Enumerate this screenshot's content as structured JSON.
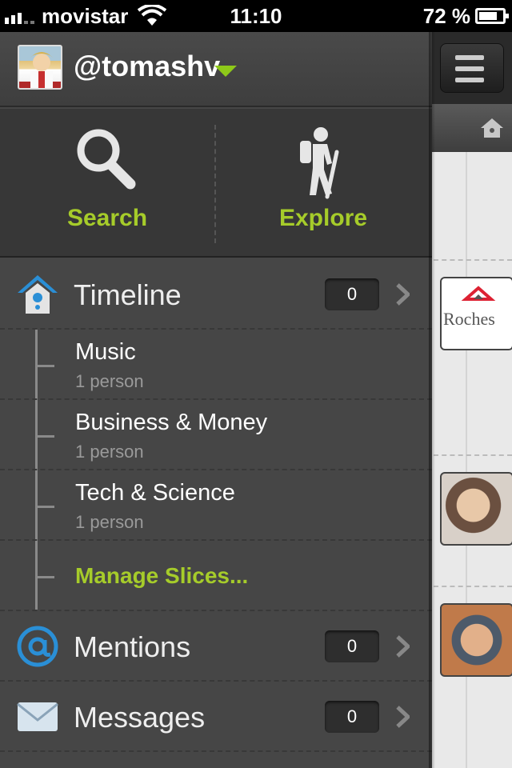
{
  "status_bar": {
    "carrier": "movistar",
    "time": "11:10",
    "battery": "72 %"
  },
  "profile": {
    "username": "@tomashv",
    "online_color": "#8ec919"
  },
  "actions": [
    {
      "label": "Search",
      "icon": "magnifier-icon"
    },
    {
      "label": "Explore",
      "icon": "hiker-icon"
    }
  ],
  "nav": {
    "timeline": {
      "title": "Timeline",
      "count": "0"
    },
    "mentions": {
      "title": "Mentions",
      "count": "0"
    },
    "messages": {
      "title": "Messages",
      "count": "0"
    }
  },
  "slices": [
    {
      "name": "Music",
      "members": "1 person"
    },
    {
      "name": "Business & Money",
      "members": "1 person"
    },
    {
      "name": "Tech & Science",
      "members": "1 person"
    }
  ],
  "manage_label": "Manage Slices...",
  "timeline_preview": {
    "logo_text": "Roches"
  },
  "colors": {
    "accent_green": "#a6cc2a",
    "menu_bg": "#464646",
    "mention_blue": "#2a8fd6"
  }
}
